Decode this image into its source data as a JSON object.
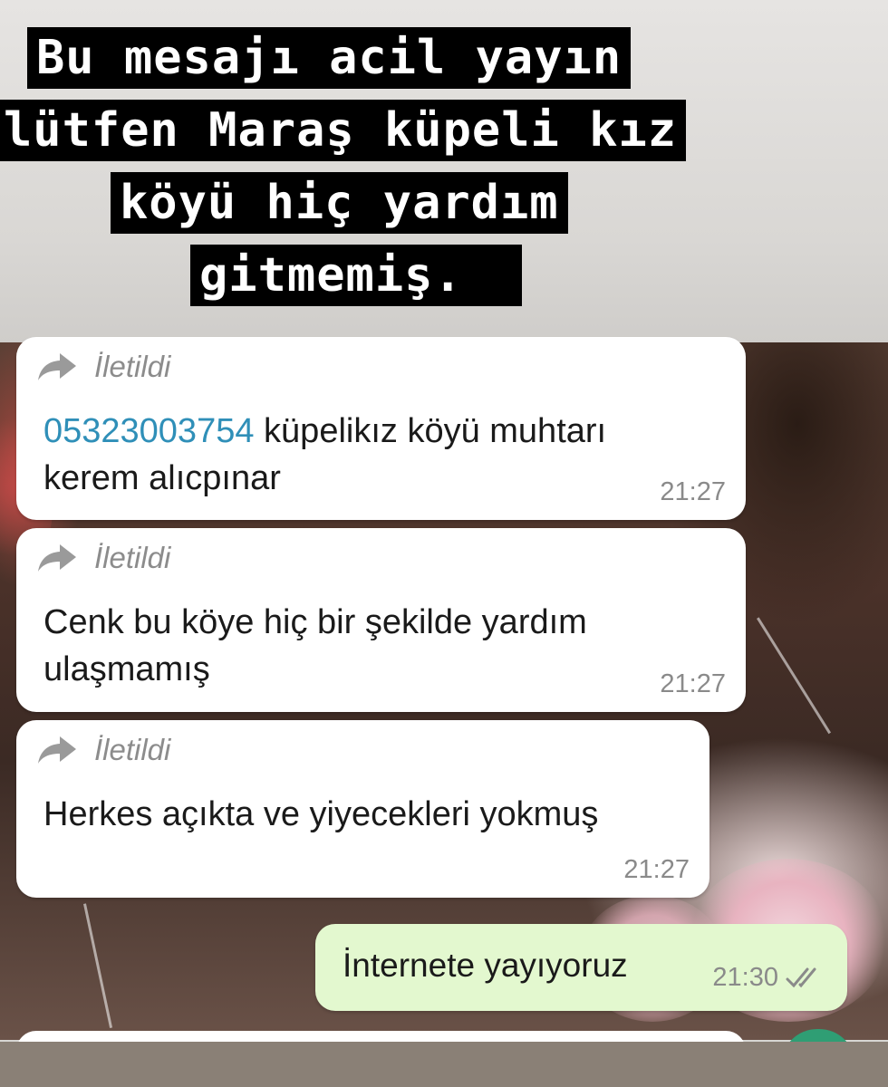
{
  "caption": {
    "lines": [
      "Bu mesajı acil yayın",
      "lütfen Maraş küpeli kız",
      "köyü hiç yardım",
      "gitmemiş."
    ]
  },
  "messages": [
    {
      "forwarded_label": "İletildi",
      "phone": "05323003754",
      "text": "küpelikız köyü muhtarı kerem alıcpınar",
      "time": "21:27"
    },
    {
      "forwarded_label": "İletildi",
      "text": "Cenk bu köye hiç bir şekilde yardım ulaşmamış",
      "time": "21:27"
    },
    {
      "forwarded_label": "İletildi",
      "text": "Herkes açıkta ve yiyecekleri yokmuş",
      "time": "21:27"
    }
  ],
  "outgoing": {
    "text": "İnternete yayıyoruz",
    "time": "21:30",
    "status_icon": "double-check-icon"
  },
  "colors": {
    "incoming_bubble": "#ffffff",
    "outgoing_bubble": "#e3f8cf",
    "link": "#2f8fb8",
    "caption_bg": "#000000",
    "caption_text": "#ffffff"
  }
}
